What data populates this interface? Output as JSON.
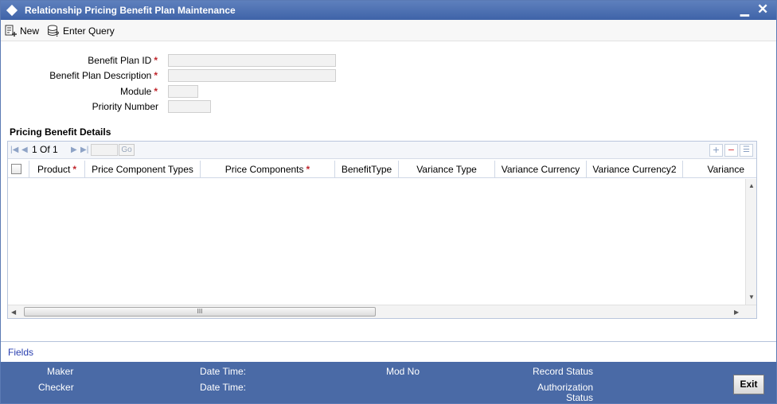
{
  "window": {
    "title": "Relationship Pricing Benefit Plan Maintenance",
    "min_symbol": "▁",
    "close_symbol": "✕"
  },
  "toolbar": {
    "new_label": "New",
    "enter_query_label": "Enter Query"
  },
  "form": {
    "benefit_plan_id_label": "Benefit Plan ID",
    "benefit_plan_desc_label": "Benefit Plan Description",
    "module_label": "Module",
    "priority_number_label": "Priority Number",
    "required_marker": "*"
  },
  "details": {
    "section_title": "Pricing Benefit Details",
    "pager": {
      "current": "1",
      "of": "Of",
      "total": "1",
      "go": "Go"
    },
    "columns": [
      "Product",
      "Price Component Types",
      "Price Components",
      "BenefitType",
      "Variance Type",
      "Variance Currency",
      "Variance Currency2",
      "Variance"
    ],
    "scroll_thumb": "III"
  },
  "fields_link": "Fields",
  "footer": {
    "maker": "Maker",
    "checker": "Checker",
    "date_time_1": "Date Time:",
    "date_time_2": "Date Time:",
    "mod_no": "Mod No",
    "record_status": "Record Status",
    "authorization_status_1": "Authorization",
    "authorization_status_2": "Status",
    "exit": "Exit"
  },
  "colors": {
    "titlebar": "#4a6aa6",
    "footer": "#4a6aa6",
    "required": "#c0262d",
    "link": "#2a40b0"
  }
}
